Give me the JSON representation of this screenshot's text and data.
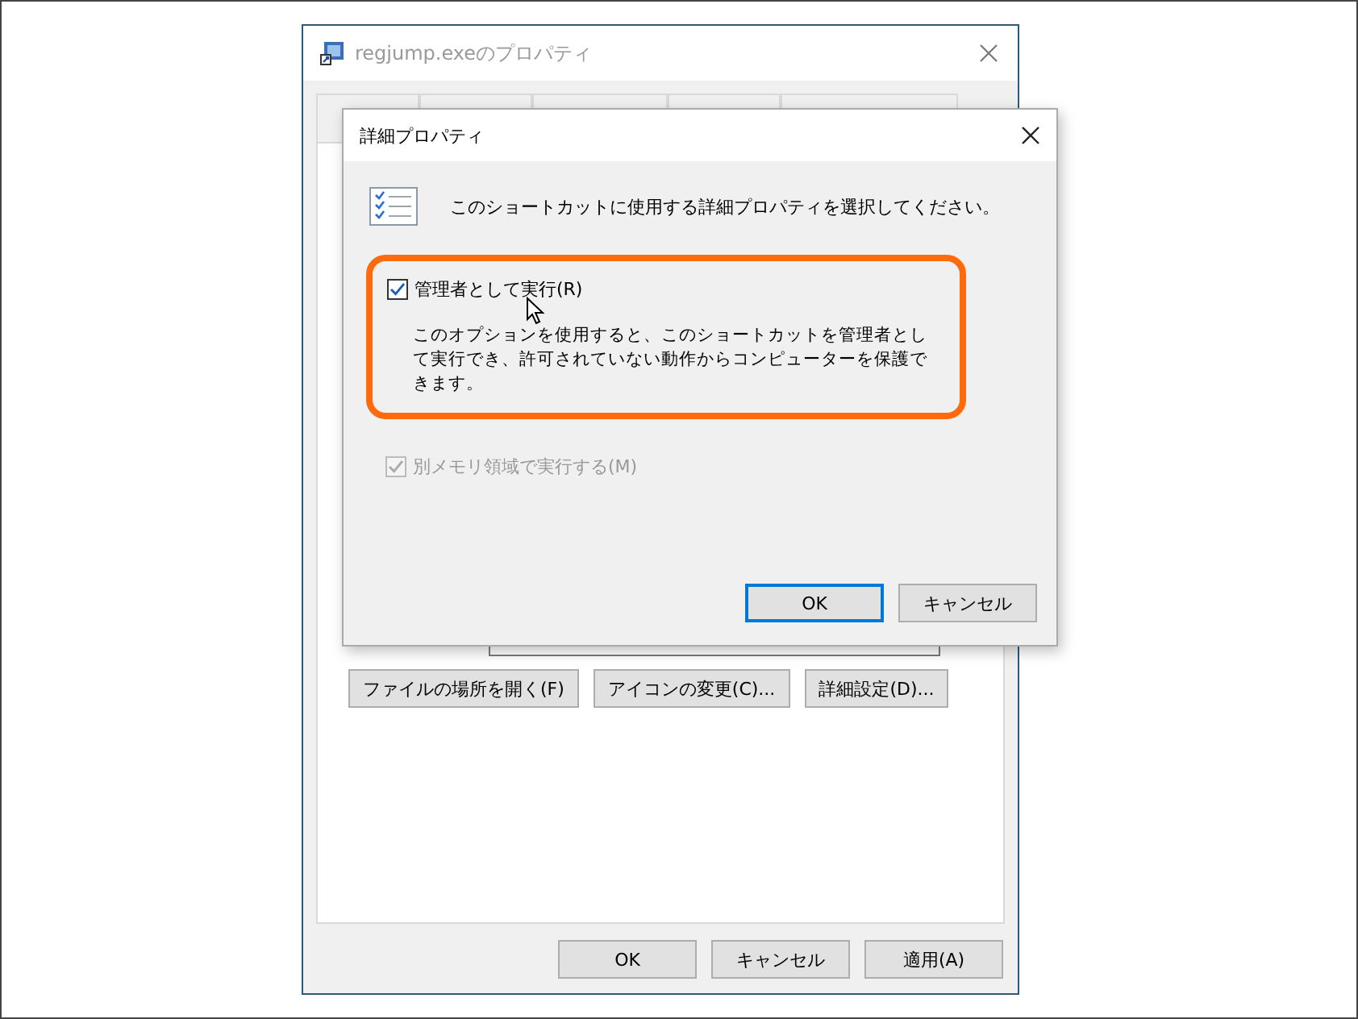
{
  "back_window": {
    "title": "regjump.exeのプロパティ",
    "action_buttons": [
      {
        "label": "ファイルの場所を開く(F)"
      },
      {
        "label": "アイコンの変更(C)..."
      },
      {
        "label": "詳細設定(D)..."
      }
    ],
    "footer_buttons": [
      {
        "label": "OK"
      },
      {
        "label": "キャンセル"
      },
      {
        "label": "適用(A)"
      }
    ]
  },
  "dialog": {
    "title": "詳細プロパティ",
    "instruction": "このショートカットに使用する詳細プロパティを選択してください。",
    "options": [
      {
        "label": "管理者として実行(R)",
        "checked": true,
        "disabled": false,
        "highlighted": true,
        "description": "このオプションを使用すると、このショートカットを管理者として実行でき、許可されていない動作からコンピューターを保護できます。"
      },
      {
        "label": "別メモリ領域で実行する(M)",
        "checked": true,
        "disabled": true,
        "highlighted": false
      }
    ],
    "buttons": [
      {
        "label": "OK",
        "default": true
      },
      {
        "label": "キャンセル",
        "default": false
      }
    ]
  }
}
